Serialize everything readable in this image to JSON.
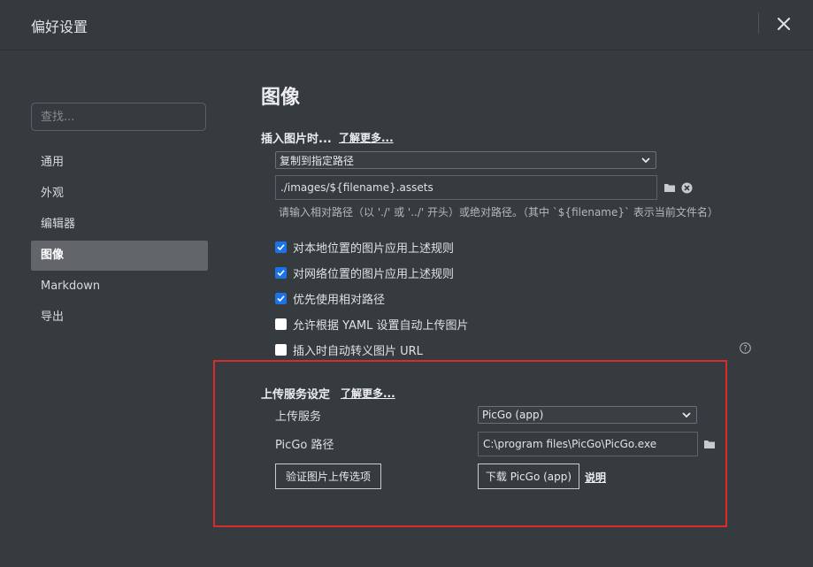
{
  "window": {
    "title": "偏好设置"
  },
  "sidebar": {
    "search_placeholder": "查找...",
    "items": [
      {
        "label": "通用",
        "active": false
      },
      {
        "label": "外观",
        "active": false
      },
      {
        "label": "编辑器",
        "active": false
      },
      {
        "label": "图像",
        "active": true
      },
      {
        "label": "Markdown",
        "active": false
      },
      {
        "label": "导出",
        "active": false
      }
    ]
  },
  "main": {
    "title": "图像",
    "insert": {
      "label": "插入图片时...",
      "learn_more": "了解更多...",
      "action_selected": "复制到指定路径",
      "path_value": "./images/${filename}.assets",
      "hint": "请输入相对路径（以 './' 或 '../' 开头）或绝对路径。（其中 `${filename}` 表示当前文件名）"
    },
    "options": [
      {
        "label": "对本地位置的图片应用上述规则",
        "checked": true
      },
      {
        "label": "对网络位置的图片应用上述规则",
        "checked": true
      },
      {
        "label": "优先使用相对路径",
        "checked": true
      },
      {
        "label": "允许根据 YAML 设置自动上传图片",
        "checked": false
      },
      {
        "label": "插入时自动转义图片 URL",
        "checked": false
      }
    ],
    "upload": {
      "label": "上传服务设定",
      "learn_more": "了解更多...",
      "service_label": "上传服务",
      "service_selected": "PicGo (app)",
      "path_label": "PicGo 路径",
      "path_value": "C:\\program files\\PicGo\\PicGo.exe",
      "verify_button": "验证图片上传选项",
      "download_button": "下载 PicGo (app)",
      "explain_link": "说明"
    }
  },
  "colors": {
    "background": "#363b40",
    "checkbox_accent": "#1a73e8",
    "highlight_frame": "#d92b2b",
    "active_nav": "#62666b"
  }
}
